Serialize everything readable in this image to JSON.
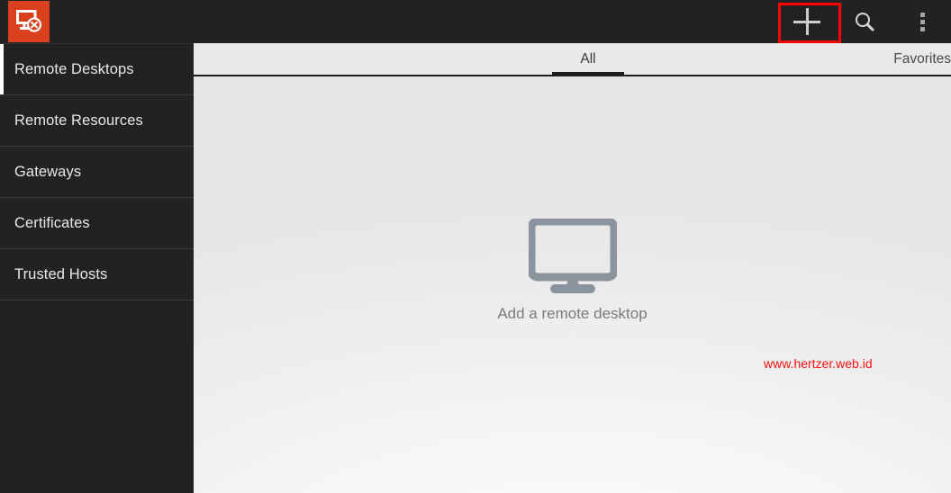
{
  "app": {
    "logo_icon": "remote-desktop-logo-icon",
    "logo_bg": "#d9411e"
  },
  "appbar": {
    "actions": [
      {
        "id": "add",
        "icon": "plus-icon",
        "label": "Add"
      },
      {
        "id": "search",
        "icon": "search-icon",
        "label": "Search"
      },
      {
        "id": "overflow",
        "icon": "overflow-menu-icon",
        "label": "More options"
      }
    ],
    "highlight_color": "#ff0000",
    "highlighted_action": "add"
  },
  "sidebar": {
    "items": [
      {
        "label": "Remote Desktops",
        "active": true
      },
      {
        "label": "Remote Resources",
        "active": false
      },
      {
        "label": "Gateways",
        "active": false
      },
      {
        "label": "Certificates",
        "active": false
      },
      {
        "label": "Trusted Hosts",
        "active": false
      }
    ]
  },
  "tabs": [
    {
      "label": "All",
      "selected": true
    },
    {
      "label": "Favorites",
      "selected": false
    }
  ],
  "empty_state": {
    "icon": "monitor-icon",
    "message": "Add a remote desktop"
  },
  "watermark": {
    "text": "www.hertzer.web.id",
    "color": "#ff1010"
  }
}
